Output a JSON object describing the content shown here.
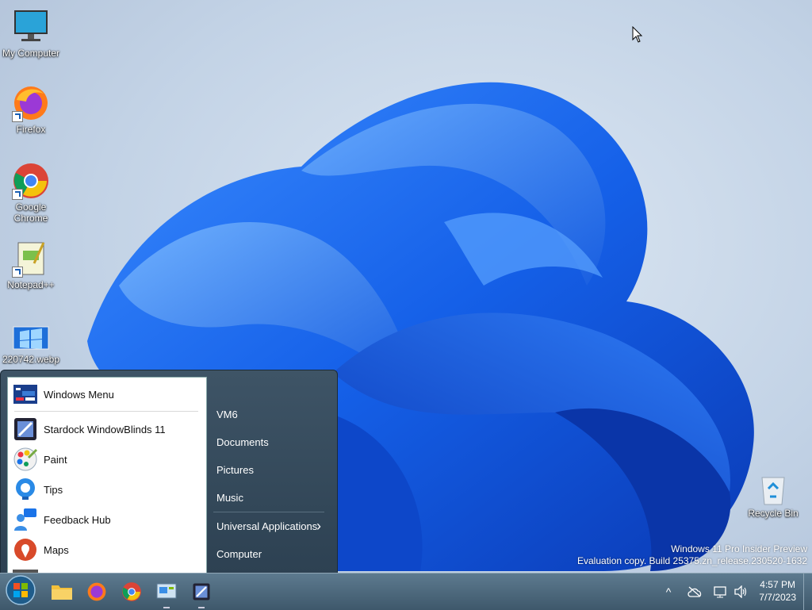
{
  "desktop": {
    "icons": [
      {
        "label": "My Computer"
      },
      {
        "label": "Firefox"
      },
      {
        "label": "Google Chrome"
      },
      {
        "label": "Notepad++"
      },
      {
        "label": "220742.webp"
      },
      {
        "label": "Recycle Bin"
      }
    ],
    "watermark": {
      "line1": "Windows 11 Pro Insider Preview",
      "line2": "Evaluation copy. Build 25375.zn_release.230520-1632"
    }
  },
  "start_menu": {
    "pinned": [
      {
        "label": "Windows Menu",
        "icon": "windows-menu-icon"
      },
      {
        "label": "Stardock WindowBlinds 11",
        "icon": "windowblinds-icon"
      },
      {
        "label": "Paint",
        "icon": "paint-icon"
      },
      {
        "label": "Tips",
        "icon": "tips-icon"
      },
      {
        "label": "Feedback Hub",
        "icon": "feedback-hub-icon"
      },
      {
        "label": "Maps",
        "icon": "maps-icon"
      }
    ],
    "places": [
      {
        "label": "VM6"
      },
      {
        "label": "Documents"
      },
      {
        "label": "Pictures"
      },
      {
        "label": "Music"
      },
      {
        "label": "Universal Applications",
        "has_submenu": true
      },
      {
        "label": "Computer"
      }
    ],
    "submenu_glyph": "›"
  },
  "taskbar": {
    "items": [
      "start-orb-icon",
      "file-explorer-icon",
      "firefox-icon",
      "chrome-icon",
      "control-panel-icon",
      "windowblinds-icon"
    ],
    "tray": {
      "chevron": "^",
      "time": "4:57 PM",
      "date": "7/7/2023"
    }
  },
  "colors": {
    "accent": "#1a73e8",
    "taskbar": "#4a667a",
    "start_menu": "#34495a"
  }
}
